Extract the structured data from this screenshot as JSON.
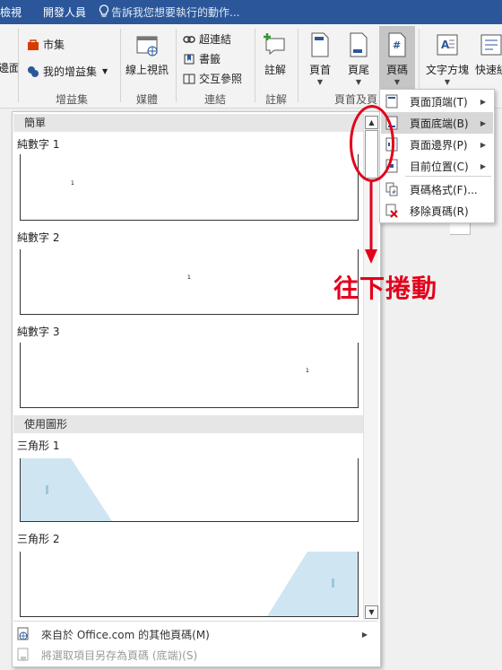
{
  "titlebar": {
    "tabs": [
      "檢視",
      "開發人員"
    ],
    "tell_me": "告訴我您想要執行的動作..."
  },
  "ribbon": {
    "left_cut_label": "邊面",
    "groups": {
      "addins": {
        "label": "增益集",
        "store": "市集",
        "my_addins": "我的增益集"
      },
      "media": {
        "label": "媒體",
        "online_video": "線上視訊"
      },
      "links": {
        "label": "連結",
        "hyperlink": "超連結",
        "bookmark": "書籤",
        "cross_ref": "交互參照"
      },
      "comments": {
        "label": "註解",
        "comment": "註解"
      },
      "header_footer": {
        "label": "頁首及頁",
        "header": "頁首",
        "footer": "頁尾",
        "page_number": "頁碼"
      },
      "text": {
        "textbox": "文字方塊",
        "quickparts": "快速組"
      }
    }
  },
  "gallery": {
    "sections": [
      {
        "title": "簡單"
      },
      {
        "title": "使用圖形"
      }
    ],
    "items": [
      "純數字 1",
      "純數字 2",
      "純數字 3",
      "三角形 1",
      "三角形 2"
    ],
    "page_number_glyph": "1",
    "footer_items": [
      "來自於 Office.com 的其他頁碼(M)",
      "將選取項目另存為頁碼 (底端)(S)"
    ]
  },
  "menu": {
    "items": [
      {
        "label": "頁面頂端(T)",
        "submenu": true
      },
      {
        "label": "頁面底端(B)",
        "submenu": true
      },
      {
        "label": "頁面邊界(P)",
        "submenu": true
      },
      {
        "label": "目前位置(C)",
        "submenu": true
      },
      {
        "label": "頁碼格式(F)...",
        "submenu": false
      },
      {
        "label": "移除頁碼(R)",
        "submenu": false
      }
    ]
  },
  "annotation": {
    "text": "往下捲動"
  },
  "colors": {
    "title_bar": "#2b579a",
    "annotation_red": "#e3001b",
    "triangle_fill": "#cfe6f2",
    "menu_highlight": "#d7d7d7"
  }
}
